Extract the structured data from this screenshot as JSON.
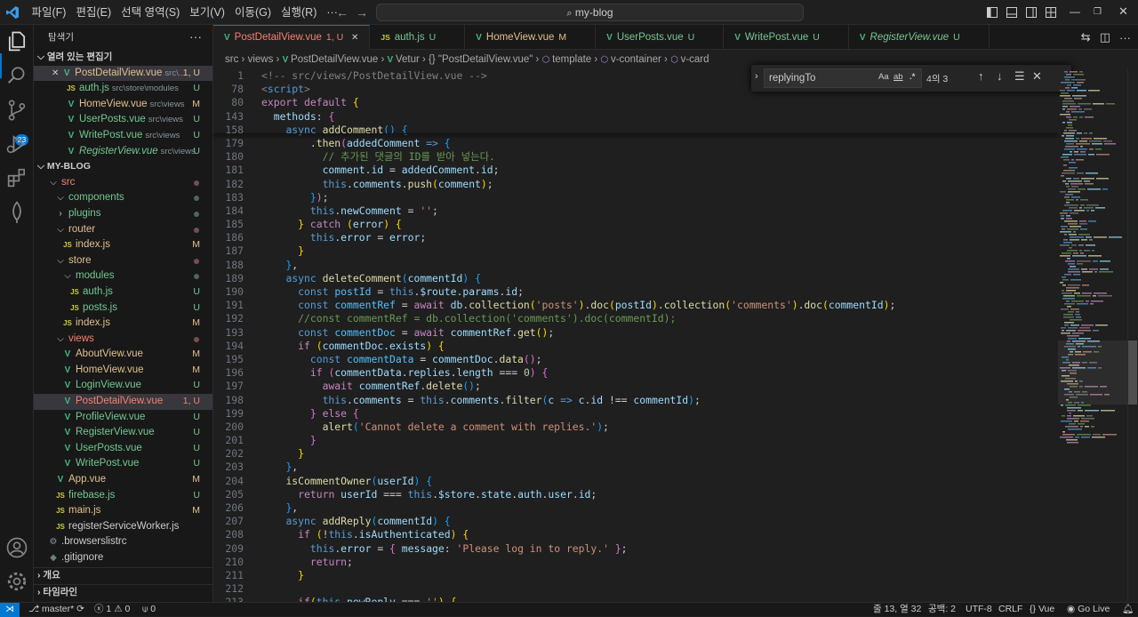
{
  "titlebar": {
    "menu": [
      "파일(F)",
      "편집(E)",
      "선택 영역(S)",
      "보기(V)",
      "이동(G)",
      "실행(R)",
      "···"
    ],
    "search_text": "my-blog"
  },
  "activity": {
    "source_control_badge": "23"
  },
  "sidebar": {
    "title": "탐색기",
    "open_editors_header": "열려 있는 편집기",
    "open_editors": [
      {
        "name": "PostDetailView.vue",
        "desc": "src\\...",
        "status": "1, U",
        "type": "vue",
        "color": "#e2c08d"
      },
      {
        "name": "auth.js",
        "desc": "src\\store\\modules",
        "status": "U",
        "type": "js",
        "color": "#73c991"
      },
      {
        "name": "HomeView.vue",
        "desc": "src\\views",
        "status": "M",
        "type": "vue",
        "color": "#e2c08d"
      },
      {
        "name": "UserPosts.vue",
        "desc": "src\\views",
        "status": "U",
        "type": "vue",
        "color": "#73c991"
      },
      {
        "name": "WritePost.vue",
        "desc": "src\\views",
        "status": "U",
        "type": "vue",
        "color": "#73c991"
      },
      {
        "name": "RegisterView.vue",
        "desc": "src\\views",
        "status": "U",
        "type": "vue",
        "color": "#73c991"
      }
    ],
    "project_header": "MY-BLOG",
    "tree": [
      {
        "name": "src",
        "depth": 1,
        "kind": "folder-open",
        "color": "#f88070",
        "status": "dot"
      },
      {
        "name": "components",
        "depth": 2,
        "kind": "folder-open",
        "color": "#73c991",
        "status": "dotg"
      },
      {
        "name": "plugins",
        "depth": 2,
        "kind": "folder",
        "color": "#73c991",
        "status": "dotg"
      },
      {
        "name": "router",
        "depth": 2,
        "kind": "folder-open",
        "color": "#e2c08d",
        "status": "dot"
      },
      {
        "name": "index.js",
        "depth": 3,
        "kind": "js",
        "color": "#e2c08d",
        "status": "M"
      },
      {
        "name": "store",
        "depth": 2,
        "kind": "folder-open",
        "color": "#e2c08d",
        "status": "dot"
      },
      {
        "name": "modules",
        "depth": 3,
        "kind": "folder-open",
        "color": "#73c991",
        "status": "dotg"
      },
      {
        "name": "auth.js",
        "depth": 4,
        "kind": "js",
        "color": "#73c991",
        "status": "U"
      },
      {
        "name": "posts.js",
        "depth": 4,
        "kind": "js",
        "color": "#73c991",
        "status": "U"
      },
      {
        "name": "index.js",
        "depth": 3,
        "kind": "js",
        "color": "#e2c08d",
        "status": "M"
      },
      {
        "name": "views",
        "depth": 2,
        "kind": "folder-open",
        "color": "#f88070",
        "status": "dot"
      },
      {
        "name": "AboutView.vue",
        "depth": 3,
        "kind": "vue",
        "color": "#e2c08d",
        "status": "M"
      },
      {
        "name": "HomeView.vue",
        "depth": 3,
        "kind": "vue",
        "color": "#e2c08d",
        "status": "M"
      },
      {
        "name": "LoginView.vue",
        "depth": 3,
        "kind": "vue",
        "color": "#73c991",
        "status": "U"
      },
      {
        "name": "PostDetailView.vue",
        "depth": 3,
        "kind": "vue",
        "color": "#f88070",
        "status": "1, U",
        "selected": true
      },
      {
        "name": "ProfileView.vue",
        "depth": 3,
        "kind": "vue",
        "color": "#73c991",
        "status": "U"
      },
      {
        "name": "RegisterView.vue",
        "depth": 3,
        "kind": "vue",
        "color": "#73c991",
        "status": "U"
      },
      {
        "name": "UserPosts.vue",
        "depth": 3,
        "kind": "vue",
        "color": "#73c991",
        "status": "U"
      },
      {
        "name": "WritePost.vue",
        "depth": 3,
        "kind": "vue",
        "color": "#73c991",
        "status": "U"
      },
      {
        "name": "App.vue",
        "depth": 2,
        "kind": "vue",
        "color": "#e2c08d",
        "status": "M"
      },
      {
        "name": "firebase.js",
        "depth": 2,
        "kind": "js",
        "color": "#73c991",
        "status": "U"
      },
      {
        "name": "main.js",
        "depth": 2,
        "kind": "js",
        "color": "#e2c08d",
        "status": "M"
      },
      {
        "name": "registerServiceWorker.js",
        "depth": 2,
        "kind": "js",
        "color": "#cccccc",
        "status": ""
      },
      {
        "name": ".browserslistrc",
        "depth": 1,
        "kind": "cfg",
        "color": "#cccccc",
        "status": ""
      },
      {
        "name": ".gitignore",
        "depth": 1,
        "kind": "git",
        "color": "#cccccc",
        "status": ""
      }
    ],
    "outline_header": "개요",
    "timeline_header": "타임라인"
  },
  "tabs": [
    {
      "name": "PostDetailView.vue",
      "status": "1, U",
      "type": "vue",
      "color": "#f88070",
      "active": true
    },
    {
      "name": "auth.js",
      "status": "U",
      "type": "js",
      "color": "#73c991"
    },
    {
      "name": "HomeView.vue",
      "status": "M",
      "type": "vue",
      "color": "#e2c08d"
    },
    {
      "name": "UserPosts.vue",
      "status": "U",
      "type": "vue",
      "color": "#73c991"
    },
    {
      "name": "WritePost.vue",
      "status": "U",
      "type": "vue",
      "color": "#73c991"
    },
    {
      "name": "RegisterView.vue",
      "status": "U",
      "type": "vue",
      "color": "#73c991",
      "italic": true
    }
  ],
  "breadcrumb": [
    "src",
    "views",
    "PostDetailView.vue",
    "Vetur",
    "{} \"PostDetailView.vue\"",
    "template",
    "v-container",
    "v-card"
  ],
  "find": {
    "value": "replyingTo",
    "opt_case": "Aa",
    "opt_word": "ab",
    "opt_regex": ".*",
    "count": "4의 3"
  },
  "code": [
    {
      "n": "1",
      "h": "<span class=\"tag\">&lt;!-- src/views/PostDetailView.vue --&gt;</span>",
      "i": 0
    },
    {
      "n": "78",
      "h": "<span class=\"tag\">&lt;</span><span class=\"tgn\">script</span><span class=\"tag\">&gt;</span>",
      "i": 0
    },
    {
      "n": "80",
      "h": "<span class=\"kc\">export default</span> <span class=\"br1\">{</span>",
      "i": 0
    },
    {
      "n": "143",
      "h": "  <span class=\"var\">methods</span>: <span class=\"br2\">{</span>",
      "i": 0
    },
    {
      "n": "158",
      "h": "    <span class=\"kw\">async</span> <span class=\"fn\">addComment</span><span class=\"br3\">()</span> <span class=\"br3\">{</span>",
      "i": 0
    },
    {
      "n": "179",
      "h": "        .<span class=\"fn\">then</span><span class=\"br2\">(</span><span class=\"var\">addedComment</span> <span class=\"kw\">=&gt;</span> <span class=\"br3\">{</span>",
      "i": 0
    },
    {
      "n": "180",
      "h": "          <span class=\"cmt\">// 추가된 댓글의 ID를 받아 넣는다.</span>",
      "i": 0
    },
    {
      "n": "181",
      "h": "          <span class=\"var\">comment</span>.<span class=\"var\">id</span> = <span class=\"var\">addedComment</span>.<span class=\"var\">id</span>;",
      "i": 0
    },
    {
      "n": "182",
      "h": "          <span class=\"this\">this</span>.<span class=\"var\">comments</span>.<span class=\"fn\">push</span><span class=\"br1\">(</span><span class=\"var\">comment</span><span class=\"br1\">)</span>;",
      "i": 0
    },
    {
      "n": "183",
      "h": "        <span class=\"br3\">}</span><span class=\"br2\">)</span>;",
      "i": 0
    },
    {
      "n": "184",
      "h": "        <span class=\"this\">this</span>.<span class=\"var\">newComment</span> = <span class=\"str\">''</span>;",
      "i": 0
    },
    {
      "n": "185",
      "h": "      <span class=\"br1\">}</span> <span class=\"kc\">catch</span> <span class=\"br1\">(</span><span class=\"var\">error</span><span class=\"br1\">)</span> <span class=\"br1\">{</span>",
      "i": 0
    },
    {
      "n": "186",
      "h": "        <span class=\"this\">this</span>.<span class=\"var\">error</span> = <span class=\"var\">error</span>;",
      "i": 0
    },
    {
      "n": "187",
      "h": "      <span class=\"br1\">}</span>",
      "i": 0
    },
    {
      "n": "188",
      "h": "    <span class=\"br3\">}</span>,",
      "i": 0
    },
    {
      "n": "189",
      "h": "    <span class=\"kw\">async</span> <span class=\"fn\">deleteComment</span><span class=\"br3\">(</span><span class=\"var\">commentId</span><span class=\"br3\">)</span> <span class=\"br3\">{</span>",
      "i": 0
    },
    {
      "n": "190",
      "h": "      <span class=\"kw\">const</span> <span class=\"ct\">postId</span> = <span class=\"this\">this</span>.<span class=\"var\">$route</span>.<span class=\"var\">params</span>.<span class=\"var\">id</span>;",
      "i": 0
    },
    {
      "n": "191",
      "h": "      <span class=\"kw\">const</span> <span class=\"ct\">commentRef</span> = <span class=\"kc\">await</span> <span class=\"var\">db</span>.<span class=\"fn\">collection</span><span class=\"br1\">(</span><span class=\"str\">'posts'</span><span class=\"br1\">)</span>.<span class=\"fn\">doc</span><span class=\"br1\">(</span><span class=\"var\">postId</span><span class=\"br1\">)</span>.<span class=\"fn\">collection</span><span class=\"br1\">(</span><span class=\"str\">'comments'</span><span class=\"br1\">)</span>.<span class=\"fn\">doc</span><span class=\"br1\">(</span><span class=\"var\">commentId</span><span class=\"br1\">)</span>;",
      "i": 0
    },
    {
      "n": "192",
      "h": "      <span class=\"cmt\">//const commentRef = db.collection('comments').doc(commentId);</span>",
      "i": 0
    },
    {
      "n": "193",
      "h": "      <span class=\"kw\">const</span> <span class=\"ct\">commentDoc</span> = <span class=\"kc\">await</span> <span class=\"var\">commentRef</span>.<span class=\"fn\">get</span><span class=\"br1\">()</span>;",
      "i": 0
    },
    {
      "n": "194",
      "h": "      <span class=\"kc\">if</span> <span class=\"br1\">(</span><span class=\"var\">commentDoc</span>.<span class=\"var\">exists</span><span class=\"br1\">)</span> <span class=\"br1\">{</span>",
      "i": 0
    },
    {
      "n": "195",
      "h": "        <span class=\"kw\">const</span> <span class=\"ct\">commentData</span> = <span class=\"var\">commentDoc</span>.<span class=\"fn\">data</span><span class=\"br2\">()</span>;",
      "i": 0
    },
    {
      "n": "196",
      "h": "        <span class=\"kc\">if</span> <span class=\"br2\">(</span><span class=\"var\">commentData</span>.<span class=\"var\">replies</span>.<span class=\"var\">length</span> === <span class=\"num\">0</span><span class=\"br2\">)</span> <span class=\"br2\">{</span>",
      "i": 0
    },
    {
      "n": "197",
      "h": "          <span class=\"kc\">await</span> <span class=\"var\">commentRef</span>.<span class=\"fn\">delete</span><span class=\"br3\">()</span>;",
      "i": 0
    },
    {
      "n": "198",
      "h": "          <span class=\"this\">this</span>.<span class=\"var\">comments</span> = <span class=\"this\">this</span>.<span class=\"var\">comments</span>.<span class=\"fn\">filter</span><span class=\"br3\">(</span><span class=\"var\">c</span> <span class=\"kw\">=&gt;</span> <span class=\"var\">c</span>.<span class=\"var\">id</span> !== <span class=\"var\">commentId</span><span class=\"br3\">)</span>;",
      "i": 0
    },
    {
      "n": "199",
      "h": "        <span class=\"br2\">}</span> <span class=\"kc\">else</span> <span class=\"br2\">{</span>",
      "i": 0
    },
    {
      "n": "200",
      "h": "          <span class=\"fn\">alert</span><span class=\"br3\">(</span><span class=\"str\">'Cannot delete a comment with replies.'</span><span class=\"br3\">)</span>;",
      "i": 0
    },
    {
      "n": "201",
      "h": "        <span class=\"br2\">}</span>",
      "i": 0
    },
    {
      "n": "202",
      "h": "      <span class=\"br1\">}</span>",
      "i": 0
    },
    {
      "n": "203",
      "h": "    <span class=\"br3\">}</span>,",
      "i": 0
    },
    {
      "n": "204",
      "h": "    <span class=\"fn\">isCommentOwner</span><span class=\"br3\">(</span><span class=\"var\">userId</span><span class=\"br3\">)</span> <span class=\"br3\">{</span>",
      "i": 0
    },
    {
      "n": "205",
      "h": "      <span class=\"kc\">return</span> <span class=\"var\">userId</span> === <span class=\"this\">this</span>.<span class=\"var\">$store</span>.<span class=\"var\">state</span>.<span class=\"var\">auth</span>.<span class=\"var\">user</span>.<span class=\"var\">id</span>;",
      "i": 0
    },
    {
      "n": "206",
      "h": "    <span class=\"br3\">}</span>,",
      "i": 0
    },
    {
      "n": "207",
      "h": "    <span class=\"kw\">async</span> <span class=\"fn\">addReply</span><span class=\"br3\">(</span><span class=\"var\">commentId</span><span class=\"br3\">)</span> <span class=\"br3\">{</span>",
      "i": 0
    },
    {
      "n": "208",
      "h": "      <span class=\"kc\">if</span> <span class=\"br1\">(</span>!<span class=\"this\">this</span>.<span class=\"var\">isAuthenticated</span><span class=\"br1\">)</span> <span class=\"br1\">{</span>",
      "i": 0
    },
    {
      "n": "209",
      "h": "        <span class=\"this\">this</span>.<span class=\"var\">error</span> = <span class=\"br2\">{</span> <span class=\"var\">message</span>: <span class=\"str\">'Please log in to reply.'</span> <span class=\"br2\">}</span>;",
      "i": 0
    },
    {
      "n": "210",
      "h": "        <span class=\"kc\">return</span>;",
      "i": 0
    },
    {
      "n": "211",
      "h": "      <span class=\"br1\">}</span>",
      "i": 0
    },
    {
      "n": "212",
      "h": "",
      "i": 0
    },
    {
      "n": "213",
      "h": "      <span class=\"kc\">if</span><span class=\"br1\">(</span><span class=\"this\">this</span>.<span class=\"var\">newReply</span> === <span class=\"str\">''</span><span class=\"br1\">)</span> <span class=\"br1\">{</span>",
      "i": 0
    }
  ],
  "statusbar": {
    "branch": "master*",
    "errors": "1",
    "warnings": "0",
    "ports": "0",
    "position": "줄 13, 열 32",
    "spaces": "공백: 2",
    "encoding": "UTF-8",
    "eol": "CRLF",
    "language": "Vue",
    "golive": "Go Live"
  },
  "colors": {
    "accent": "#0078d4",
    "modified": "#e2c08d",
    "untracked": "#73c991",
    "error": "#f88070"
  }
}
